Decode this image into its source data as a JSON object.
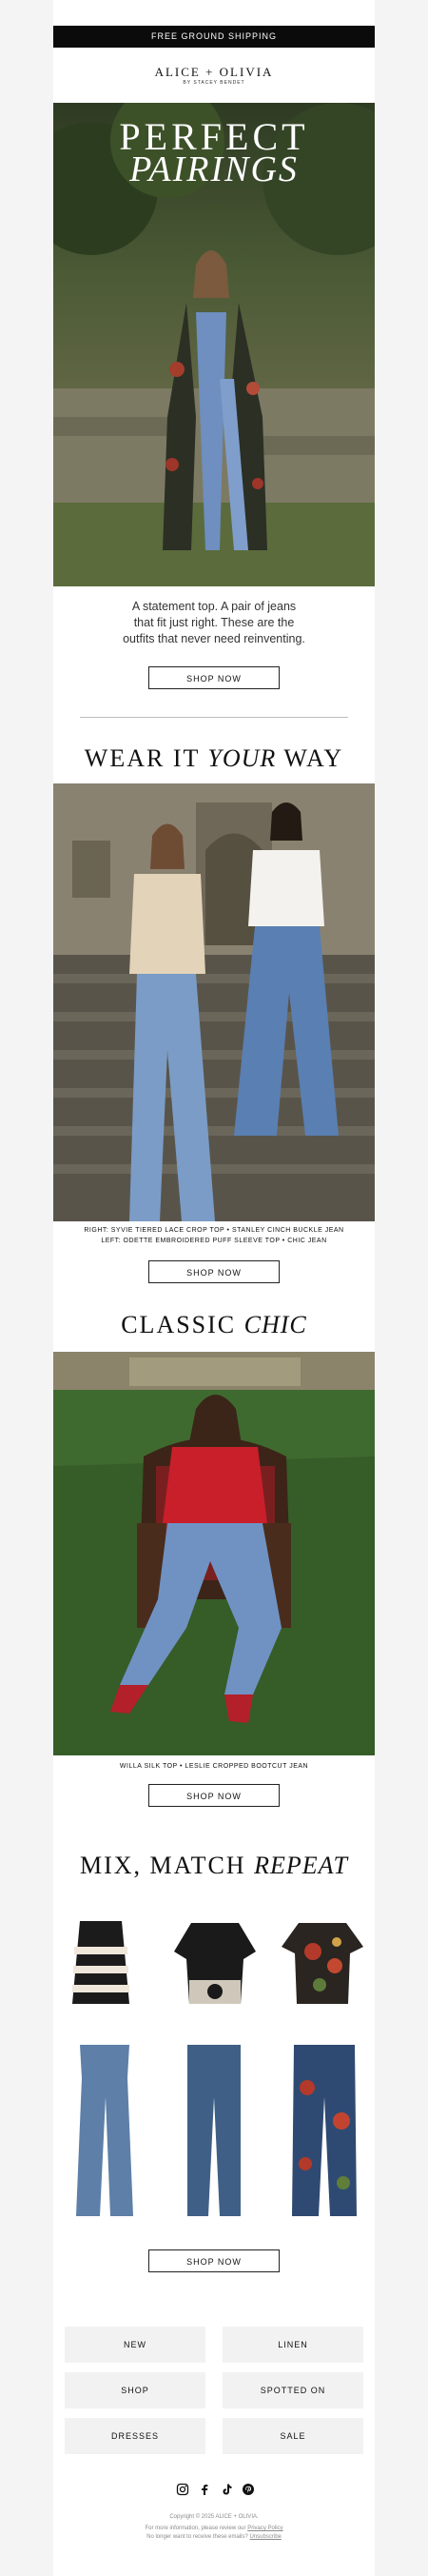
{
  "topbar": {
    "text": "FREE GROUND SHIPPING"
  },
  "brand": {
    "logo": "ALICE + OLIVIA",
    "sub": "BY STACEY BENDET"
  },
  "hero": {
    "heading_line1": "PERFECT",
    "heading_line2": "PAIRINGS",
    "copy": [
      "A statement top. A pair of jeans",
      "that fit just right. These are the",
      "outfits that never need reinventing."
    ],
    "cta": "SHOP NOW"
  },
  "section2": {
    "title_prefix": "WEAR IT ",
    "title_italic": "YOUR",
    "title_suffix": " WAY",
    "caption_line1": "RIGHT: SYVIE TIERED LACE CROP TOP • STANLEY CINCH BUCKLE JEAN",
    "caption_line2": "LEFT: ODETTE EMBROIDERED PUFF SLEEVE TOP • CHIC JEAN",
    "cta": "SHOP NOW"
  },
  "section3": {
    "title_prefix": "CLASSIC ",
    "title_italic": "CHIC",
    "caption": "WILLA SILK TOP • LESLIE CROPPED BOOTCUT JEAN",
    "cta": "SHOP NOW"
  },
  "section4": {
    "title_prefix": "MIX, MATCH ",
    "title_italic": "REPEAT",
    "cta": "SHOP NOW"
  },
  "nav": {
    "new": "NEW",
    "linen": "LINEN",
    "shop": "SHOP",
    "spotted": "SPOTTED ON",
    "dresses": "DRESSES",
    "sale": "SALE"
  },
  "social": {
    "instagram": "instagram-icon",
    "facebook": "facebook-icon",
    "tiktok": "tiktok-icon",
    "pinterest": "pinterest-icon"
  },
  "footer": {
    "copyright": "Copyright © 2025 ALICE + OLIVIA.",
    "info_prefix": "For more information, please review our ",
    "privacy": "Privacy Policy",
    "unsub_prefix": "No longer want to receive these emails? ",
    "unsubscribe": "Unsubscribe"
  }
}
